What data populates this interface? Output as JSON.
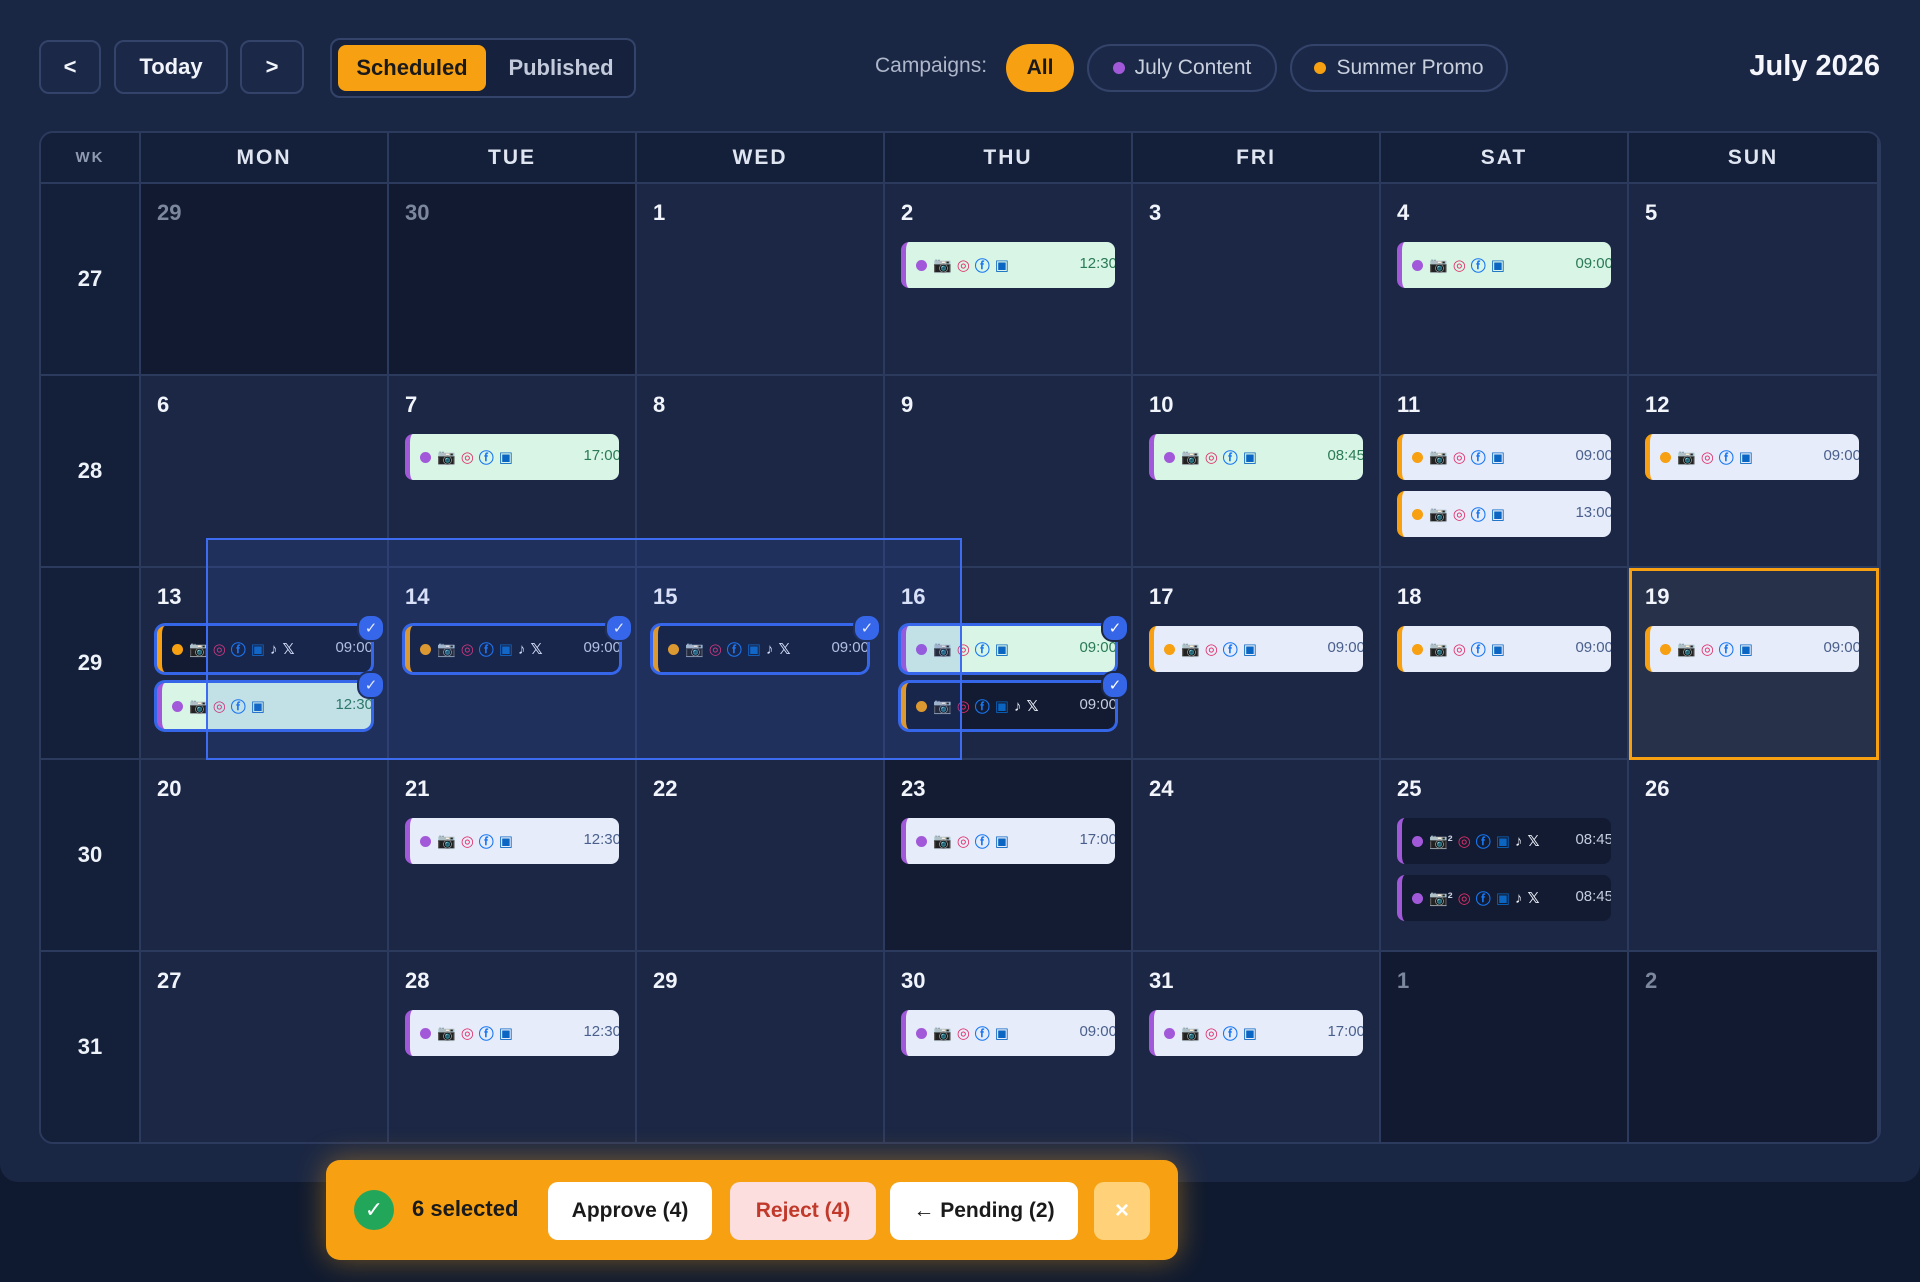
{
  "nav": {
    "prev_label": "<",
    "today_label": "Today",
    "next_label": ">"
  },
  "view_toggle": {
    "scheduled_label": "Scheduled",
    "published_label": "Published"
  },
  "campaigns": {
    "label": "Campaigns:",
    "all_label": "All",
    "july_label": "July Content",
    "summer_label": "Summer Promo",
    "july_color": "#a259d9",
    "summer_color": "#f6a012"
  },
  "month_title": "July 2026",
  "weekday_headers": [
    "WK",
    "MON",
    "TUE",
    "WED",
    "THU",
    "FRI",
    "SAT",
    "SUN"
  ],
  "weeks": [
    {
      "wk": "27",
      "days": [
        "29",
        "30",
        "1",
        "2",
        "3",
        "4",
        "5"
      ]
    },
    {
      "wk": "28",
      "days": [
        "6",
        "7",
        "8",
        "9",
        "10",
        "11",
        "12"
      ]
    },
    {
      "wk": "29",
      "days": [
        "13",
        "14",
        "15",
        "16",
        "17",
        "18",
        "19"
      ]
    },
    {
      "wk": "30",
      "days": [
        "20",
        "21",
        "22",
        "23",
        "24",
        "25",
        "26"
      ]
    },
    {
      "wk": "31",
      "days": [
        "27",
        "28",
        "29",
        "30",
        "31",
        "1",
        "2"
      ]
    }
  ],
  "icon_names": {
    "cam": "camera-icon",
    "ig": "instagram-icon",
    "fb": "facebook-icon",
    "li": "linkedin-icon",
    "tt": "tiktok-icon",
    "xx": "x-icon",
    "check": "check-icon"
  },
  "events": [
    {
      "week": 0,
      "day": 3,
      "slot": 0,
      "campaign": "july",
      "style": "green",
      "icons": [
        "cam",
        "ig",
        "fb",
        "li"
      ],
      "time": "12:30",
      "selected": false
    },
    {
      "week": 0,
      "day": 5,
      "slot": 0,
      "campaign": "july",
      "style": "green",
      "icons": [
        "cam",
        "ig",
        "fb",
        "li"
      ],
      "time": "09:00",
      "selected": false
    },
    {
      "week": 1,
      "day": 1,
      "slot": 0,
      "campaign": "july",
      "style": "green",
      "icons": [
        "cam",
        "ig",
        "fb",
        "li"
      ],
      "time": "17:00",
      "selected": false
    },
    {
      "week": 1,
      "day": 4,
      "slot": 0,
      "campaign": "july",
      "style": "green",
      "icons": [
        "cam",
        "ig",
        "fb",
        "li"
      ],
      "time": "08:45",
      "selected": false
    },
    {
      "week": 1,
      "day": 5,
      "slot": 0,
      "campaign": "summer",
      "style": "light",
      "icons": [
        "cam",
        "ig",
        "fb",
        "li"
      ],
      "time": "09:00",
      "selected": false
    },
    {
      "week": 1,
      "day": 5,
      "slot": 1,
      "campaign": "summer",
      "style": "light",
      "icons": [
        "cam",
        "ig",
        "fb",
        "li"
      ],
      "time": "13:00",
      "selected": false
    },
    {
      "week": 1,
      "day": 6,
      "slot": 0,
      "campaign": "summer",
      "style": "light",
      "icons": [
        "cam",
        "ig",
        "fb",
        "li"
      ],
      "time": "09:00",
      "selected": false
    },
    {
      "week": 2,
      "day": 0,
      "slot": 0,
      "campaign": "summer",
      "style": "dark",
      "icons": [
        "cam",
        "ig",
        "fb",
        "li",
        "tt",
        "xx"
      ],
      "time": "09:00",
      "selected": true
    },
    {
      "week": 2,
      "day": 0,
      "slot": 1,
      "campaign": "july",
      "style": "green",
      "icons": [
        "cam",
        "ig",
        "fb",
        "li"
      ],
      "time": "12:30",
      "selected": true
    },
    {
      "week": 2,
      "day": 1,
      "slot": 0,
      "campaign": "summer",
      "style": "dark",
      "icons": [
        "cam",
        "ig",
        "fb",
        "li",
        "tt",
        "xx"
      ],
      "time": "09:00",
      "selected": true
    },
    {
      "week": 2,
      "day": 2,
      "slot": 0,
      "campaign": "summer",
      "style": "dark",
      "icons": [
        "cam",
        "ig",
        "fb",
        "li",
        "tt",
        "xx"
      ],
      "time": "09:00",
      "selected": true
    },
    {
      "week": 2,
      "day": 3,
      "slot": 0,
      "campaign": "july",
      "style": "green",
      "icons": [
        "cam",
        "ig",
        "fb",
        "li"
      ],
      "time": "09:00",
      "selected": true
    },
    {
      "week": 2,
      "day": 3,
      "slot": 1,
      "campaign": "summer",
      "style": "dark",
      "icons": [
        "cam",
        "ig",
        "fb",
        "li",
        "tt",
        "xx"
      ],
      "time": "09:00",
      "selected": true
    },
    {
      "week": 2,
      "day": 4,
      "slot": 0,
      "campaign": "summer",
      "style": "light",
      "icons": [
        "cam",
        "ig",
        "fb",
        "li"
      ],
      "time": "09:00",
      "selected": false
    },
    {
      "week": 2,
      "day": 5,
      "slot": 0,
      "campaign": "summer",
      "style": "light",
      "icons": [
        "cam",
        "ig",
        "fb",
        "li"
      ],
      "time": "09:00",
      "selected": false
    },
    {
      "week": 2,
      "day": 6,
      "slot": 0,
      "campaign": "summer",
      "style": "light",
      "icons": [
        "cam",
        "ig",
        "fb",
        "li"
      ],
      "time": "09:00",
      "selected": false
    },
    {
      "week": 3,
      "day": 1,
      "slot": 0,
      "campaign": "july",
      "style": "light",
      "icons": [
        "cam",
        "ig",
        "fb",
        "li"
      ],
      "time": "12:30",
      "selected": false
    },
    {
      "week": 3,
      "day": 3,
      "slot": 0,
      "campaign": "july",
      "style": "light",
      "icons": [
        "cam",
        "ig",
        "fb",
        "li"
      ],
      "time": "17:00",
      "selected": false
    },
    {
      "week": 3,
      "day": 5,
      "slot": 0,
      "campaign": "july",
      "style": "dark",
      "icons": [
        "cam2",
        "ig",
        "fb",
        "li",
        "tt",
        "xx"
      ],
      "time": "08:45",
      "selected": false
    },
    {
      "week": 3,
      "day": 5,
      "slot": 1,
      "campaign": "july",
      "style": "dark",
      "icons": [
        "cam2",
        "ig",
        "fb",
        "li",
        "tt",
        "xx"
      ],
      "time": "08:45",
      "selected": false
    },
    {
      "week": 4,
      "day": 1,
      "slot": 0,
      "campaign": "july",
      "style": "light",
      "icons": [
        "cam",
        "ig",
        "fb",
        "li"
      ],
      "time": "12:30",
      "selected": false
    },
    {
      "week": 4,
      "day": 3,
      "slot": 0,
      "campaign": "july",
      "style": "light",
      "icons": [
        "cam",
        "ig",
        "fb",
        "li"
      ],
      "time": "09:00",
      "selected": false
    },
    {
      "week": 4,
      "day": 4,
      "slot": 0,
      "campaign": "july",
      "style": "light",
      "icons": [
        "cam",
        "ig",
        "fb",
        "li"
      ],
      "time": "17:00",
      "selected": false
    }
  ],
  "selection_bar": {
    "count_label": "6 selected",
    "approve_label": "Approve (4)",
    "reject_label": "Reject (4)",
    "pending_label": "← Pending (2)",
    "close_label": "×"
  }
}
